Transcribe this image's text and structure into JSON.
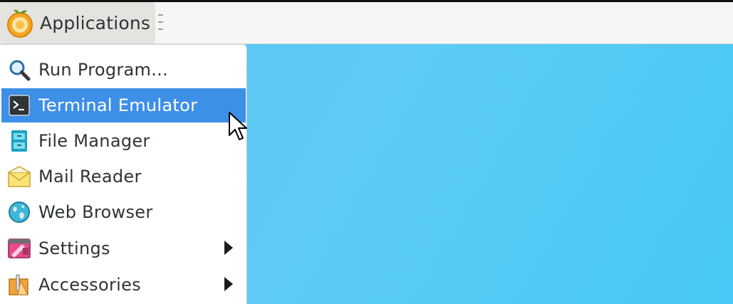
{
  "panel": {
    "app_button_label": "Applications",
    "logo_icon": "orange-logo-icon"
  },
  "menu": {
    "items": [
      {
        "label": "Run Program...",
        "icon": "search-icon",
        "submenu": false,
        "active": false
      },
      {
        "label": "Terminal Emulator",
        "icon": "terminal-icon",
        "submenu": false,
        "active": true
      },
      {
        "label": "File Manager",
        "icon": "file-manager-icon",
        "submenu": false,
        "active": false
      },
      {
        "label": "Mail Reader",
        "icon": "mail-icon",
        "submenu": false,
        "active": false
      },
      {
        "label": "Web Browser",
        "icon": "globe-icon",
        "submenu": false,
        "active": false
      },
      {
        "label": "Settings",
        "icon": "settings-icon",
        "submenu": true,
        "active": false
      },
      {
        "label": "Accessories",
        "icon": "accessories-icon",
        "submenu": true,
        "active": false
      }
    ]
  },
  "colors": {
    "desktop": "#57c4f2",
    "highlight": "#3d8fe8",
    "panel": "#f6f6f4"
  }
}
